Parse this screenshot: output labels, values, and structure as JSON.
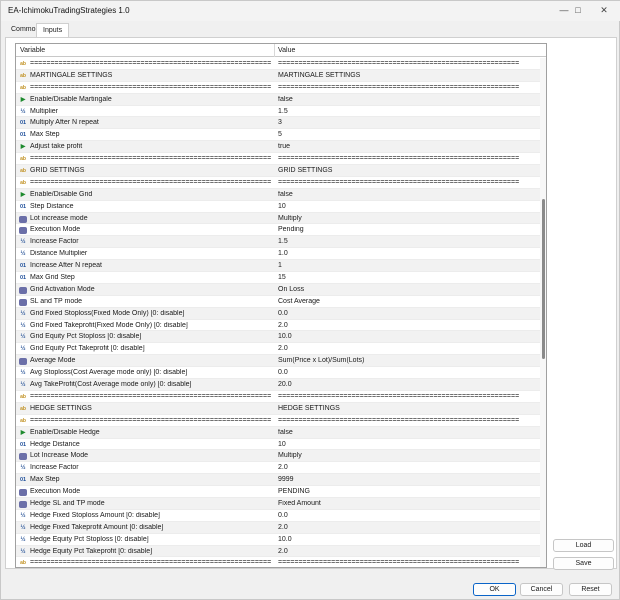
{
  "window": {
    "title": "EA-IchimokuTradingStrategies 1.0"
  },
  "tabs": [
    {
      "label": "Common"
    },
    {
      "label": "Inputs"
    }
  ],
  "grid": {
    "col_variable": "Variable",
    "col_value": "Value",
    "rows": [
      {
        "icon": "ab",
        "name": "===========================================================",
        "value": "==========================================================="
      },
      {
        "icon": "ab",
        "name": "MARTINGALE SETTINGS",
        "value": "MARTINGALE SETTINGS"
      },
      {
        "icon": "ab",
        "name": "===========================================================",
        "value": "==========================================================="
      },
      {
        "icon": "bool",
        "name": "Enable/Disable Martingale",
        "value": "false"
      },
      {
        "icon": "frac",
        "name": "Multiplier",
        "value": "1.5"
      },
      {
        "icon": "int",
        "name": "Multiply After N repeat",
        "value": "3"
      },
      {
        "icon": "int",
        "name": "Max Step",
        "value": "5"
      },
      {
        "icon": "bool",
        "name": "Adjust take profit",
        "value": "true"
      },
      {
        "icon": "ab",
        "name": "===========================================================",
        "value": "==========================================================="
      },
      {
        "icon": "ab",
        "name": "GRID SETTINGS",
        "value": "GRID SETTINGS"
      },
      {
        "icon": "ab",
        "name": "===========================================================",
        "value": "==========================================================="
      },
      {
        "icon": "bool",
        "name": "Enable/Disable Grid",
        "value": "false"
      },
      {
        "icon": "int",
        "name": "Step Distance",
        "value": "10"
      },
      {
        "icon": "enum",
        "name": "Lot increase mode",
        "value": "Multiply"
      },
      {
        "icon": "enum",
        "name": "Execution Mode",
        "value": "Pending"
      },
      {
        "icon": "frac",
        "name": "Increase Factor",
        "value": "1.5"
      },
      {
        "icon": "frac",
        "name": "Distance Multiplier",
        "value": "1.0"
      },
      {
        "icon": "int",
        "name": "Increase After N repeat",
        "value": "1"
      },
      {
        "icon": "int",
        "name": "Max Grid Step",
        "value": "15"
      },
      {
        "icon": "enum",
        "name": "Grid Activation Mode",
        "value": "On Loss"
      },
      {
        "icon": "enum",
        "name": "SL and TP mode",
        "value": "Cost Average"
      },
      {
        "icon": "frac",
        "name": "Grid Fixed Stoploss(Fixed Mode Only) [0: disable]",
        "value": "0.0"
      },
      {
        "icon": "frac",
        "name": "Grid Fixed Takeprofit(Fixed Mode Only) [0: disable]",
        "value": "2.0"
      },
      {
        "icon": "frac",
        "name": "Grid Equity Pct Stoploss [0: disable]",
        "value": "10.0"
      },
      {
        "icon": "frac",
        "name": "Grid Equity Pct Takeprofit [0: disable]",
        "value": "2.0"
      },
      {
        "icon": "enum",
        "name": "Average Mode",
        "value": "Sum(Price x Lot)/Sum(Lots)"
      },
      {
        "icon": "frac",
        "name": "Avg Stoploss(Cost Average mode only) [0: disable]",
        "value": "0.0"
      },
      {
        "icon": "frac",
        "name": "Avg TakeProfit(Cost Average mode only) [0: disable]",
        "value": "20.0"
      },
      {
        "icon": "ab",
        "name": "===========================================================",
        "value": "==========================================================="
      },
      {
        "icon": "ab",
        "name": "HEDGE SETTINGS",
        "value": "HEDGE SETTINGS"
      },
      {
        "icon": "ab",
        "name": "===========================================================",
        "value": "==========================================================="
      },
      {
        "icon": "bool",
        "name": "Enable/Disable Hedge",
        "value": "false"
      },
      {
        "icon": "int",
        "name": "Hedge Distance",
        "value": "10"
      },
      {
        "icon": "enum",
        "name": "Lot Increase Mode",
        "value": "Multiply"
      },
      {
        "icon": "frac",
        "name": "Increase Factor",
        "value": "2.0"
      },
      {
        "icon": "int",
        "name": "Max Step",
        "value": "9999"
      },
      {
        "icon": "enum",
        "name": "Execution Mode",
        "value": "PENDING"
      },
      {
        "icon": "enum",
        "name": "Hedge SL and TP mode",
        "value": "Fixed Amount"
      },
      {
        "icon": "frac",
        "name": "Hedge Fixed Stoploss Amount [0: disable]",
        "value": "0.0"
      },
      {
        "icon": "frac",
        "name": "Hedge Fixed Takeprofit Amount [0: disable]",
        "value": "2.0"
      },
      {
        "icon": "frac",
        "name": "Hedge Equity Pct Stoploss [0: disable]",
        "value": "10.0"
      },
      {
        "icon": "frac",
        "name": "Hedge Equity Pct Takeprofit [0: disable]",
        "value": "2.0"
      },
      {
        "icon": "ab",
        "name": "===========================================================",
        "value": "==========================================================="
      }
    ]
  },
  "side_buttons": {
    "load": "Load",
    "save": "Save"
  },
  "bottom_buttons": {
    "ok": "OK",
    "cancel": "Cancel",
    "reset": "Reset"
  }
}
